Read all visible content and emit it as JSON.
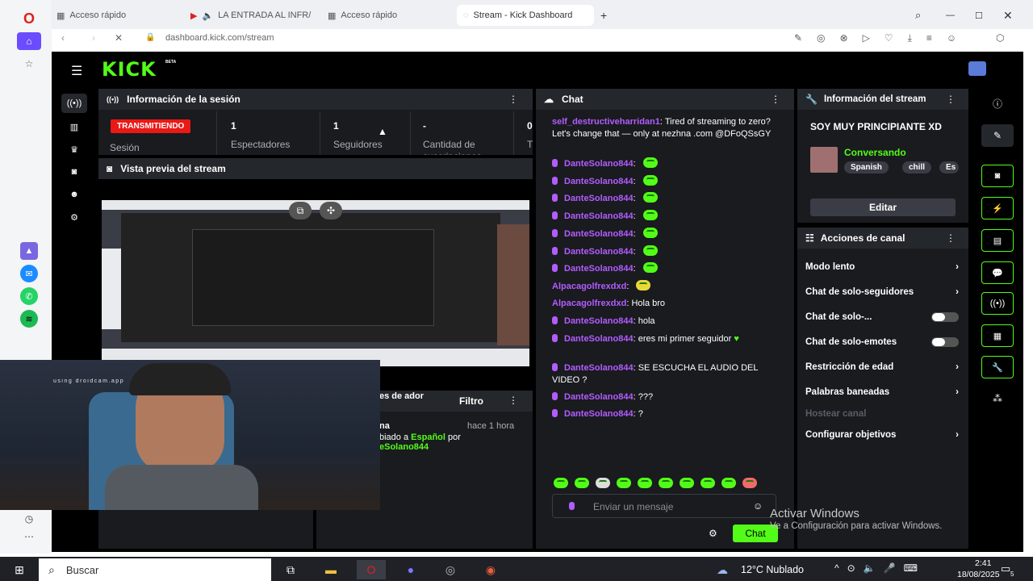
{
  "browser": {
    "tabs": [
      {
        "label": "Acceso rápido"
      },
      {
        "label": "LA ENTRADA AL INFR/"
      },
      {
        "label": "Acceso rápido"
      },
      {
        "label": "Stream - Kick Dashboard"
      }
    ],
    "url": "dashboard.kick.com/stream"
  },
  "kick": {
    "logo": "KICK",
    "logo_badge": "BETA",
    "session": {
      "title": "Información de la sesión",
      "status": "TRANSMITIENDO",
      "session_label": "Sesión",
      "stats": [
        {
          "value": "1",
          "label": "Espectadores"
        },
        {
          "value": "1",
          "label": "Seguidores"
        },
        {
          "value": "-",
          "label": "Cantidad de suscripciones"
        },
        {
          "value": "0",
          "label": "T"
        }
      ]
    },
    "preview": {
      "title": "Vista previa del stream"
    },
    "log": {
      "title_partial": "es de ador",
      "filter_label": "Filtro",
      "row_name_partial": "na",
      "row_time": "hace 1 hora",
      "row_text_partial": "biado a",
      "row_lang": "Español",
      "row_by": "por",
      "row_user_partial": "eSolano844"
    },
    "chat": {
      "title": "Chat",
      "messages": [
        {
          "user": "self_destructiveharridan1",
          "text": "Tired of streaming to zero? Let's change that — only at nezhna .com @DFoQSsGY"
        },
        {
          "user": "DanteSolano844",
          "text": ""
        },
        {
          "user": "DanteSolano844",
          "text": ""
        },
        {
          "user": "DanteSolano844",
          "text": ""
        },
        {
          "user": "DanteSolano844",
          "text": ""
        },
        {
          "user": "DanteSolano844",
          "text": ""
        },
        {
          "user": "DanteSolano844",
          "text": ""
        },
        {
          "user": "DanteSolano844",
          "text": ""
        },
        {
          "user": "Alpacagolfrexdxd",
          "text": ""
        },
        {
          "user": "Alpacagolfrexdxd",
          "text": "Hola bro"
        },
        {
          "user": "DanteSolano844",
          "text": "hola"
        },
        {
          "user": "DanteSolano844",
          "text": "eres mi primer seguidor"
        },
        {
          "user": "DanteSolano844",
          "text": "SE ESCUCHA EL AUDIO DEL VIDEO ?"
        },
        {
          "user": "DanteSolano844",
          "text": "???"
        },
        {
          "user": "DanteSolano844",
          "text": "?"
        }
      ],
      "input_placeholder": "Enviar un mensaje",
      "send_label": "Chat"
    },
    "channel_info": {
      "title": "Información del stream",
      "stream_title": "SOY MUY PRINCIPIANTE XD",
      "category": "Conversando",
      "tags": [
        "Spanish",
        "chill",
        "Es"
      ],
      "edit_label": "Editar"
    },
    "channel_actions": {
      "title": "Acciones de canal",
      "items": [
        {
          "label": "Modo lento"
        },
        {
          "label": "Chat de solo-seguidores"
        },
        {
          "label": "Chat de solo-..."
        },
        {
          "label": "Chat de solo-emotes"
        },
        {
          "label": "Restricción de edad"
        },
        {
          "label": "Palabras baneadas"
        },
        {
          "label": "Hostear canal"
        },
        {
          "label": "Configurar objetivos"
        }
      ]
    }
  },
  "overlay": {
    "watermark": "using droidcam.app",
    "activate_title": "Activar Windows",
    "activate_sub": "Ve a Configuración para activar Windows."
  },
  "taskbar": {
    "search_label": "Buscar",
    "weather": "12°C Nublado",
    "time": "2:41",
    "date": "18/08/2025",
    "notif_count": "5"
  },
  "colors": {
    "brand": "#53fc18",
    "live": "#e91916",
    "username": "#b35cff"
  }
}
